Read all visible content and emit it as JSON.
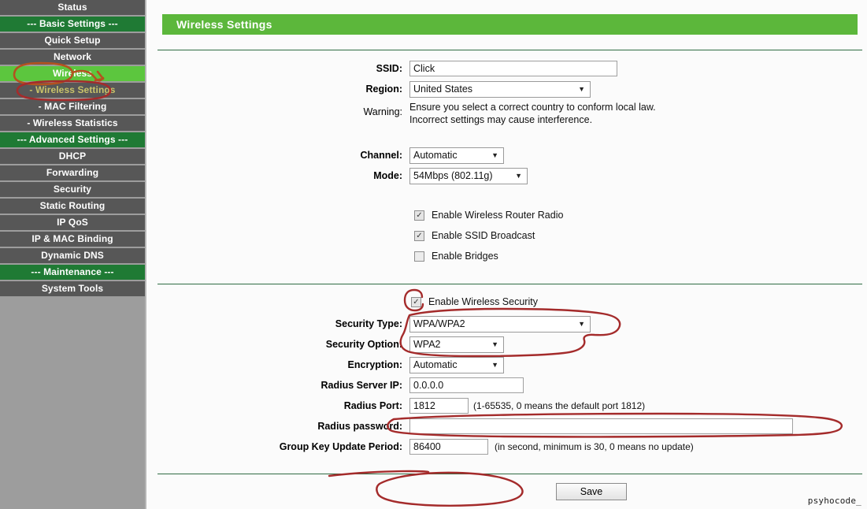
{
  "sidebar": {
    "items": [
      {
        "label": "Status",
        "type": "item"
      },
      {
        "label": "--- Basic Settings ---",
        "type": "section"
      },
      {
        "label": "Quick Setup",
        "type": "item"
      },
      {
        "label": "Network",
        "type": "item"
      },
      {
        "label": "Wireless",
        "type": "active"
      },
      {
        "label": "- Wireless Settings",
        "type": "sub"
      },
      {
        "label": "- MAC Filtering",
        "type": "sub-plain"
      },
      {
        "label": "- Wireless Statistics",
        "type": "sub-plain"
      },
      {
        "label": "--- Advanced Settings ---",
        "type": "section"
      },
      {
        "label": "DHCP",
        "type": "item"
      },
      {
        "label": "Forwarding",
        "type": "item"
      },
      {
        "label": "Security",
        "type": "item"
      },
      {
        "label": "Static Routing",
        "type": "item"
      },
      {
        "label": "IP QoS",
        "type": "item"
      },
      {
        "label": "IP & MAC Binding",
        "type": "item"
      },
      {
        "label": "Dynamic DNS",
        "type": "item"
      },
      {
        "label": "--- Maintenance ---",
        "type": "section"
      },
      {
        "label": "System Tools",
        "type": "item"
      }
    ]
  },
  "page": {
    "title": "Wireless Settings",
    "banner_color": "#5cb73b"
  },
  "form": {
    "ssid": {
      "label": "SSID:",
      "value": "Click"
    },
    "region": {
      "label": "Region:",
      "value": "United States"
    },
    "warning": {
      "label": "Warning:",
      "line1": "Ensure you select a correct country to conform local law.",
      "line2": "Incorrect settings may cause interference."
    },
    "channel": {
      "label": "Channel:",
      "value": "Automatic"
    },
    "mode": {
      "label": "Mode:",
      "value": "54Mbps (802.11g)"
    },
    "checkboxes": [
      {
        "label": "Enable Wireless Router Radio",
        "checked": true
      },
      {
        "label": "Enable SSID Broadcast",
        "checked": true
      },
      {
        "label": "Enable Bridges",
        "checked": false
      }
    ],
    "enable_security": {
      "label": "Enable Wireless Security",
      "checked": true
    },
    "security_type": {
      "label": "Security Type:",
      "value": "WPA/WPA2"
    },
    "security_option": {
      "label": "Security Option:",
      "value": "WPA2"
    },
    "encryption": {
      "label": "Encryption:",
      "value": "Automatic"
    },
    "radius_server_ip": {
      "label": "Radius Server IP:",
      "value": "0.0.0.0"
    },
    "radius_port": {
      "label": "Radius Port:",
      "value": "1812",
      "hint": "(1-65535, 0 means the default port 1812)"
    },
    "radius_password": {
      "label": "Radius password:",
      "value": ""
    },
    "group_key_update": {
      "label": "Group Key Update Period:",
      "value": "86400",
      "hint": "(in second, minimum is 30, 0 means no update)"
    },
    "save_label": "Save"
  },
  "watermark": {
    "text": "psyhocode_"
  },
  "annotation_color": "#a82a2a"
}
